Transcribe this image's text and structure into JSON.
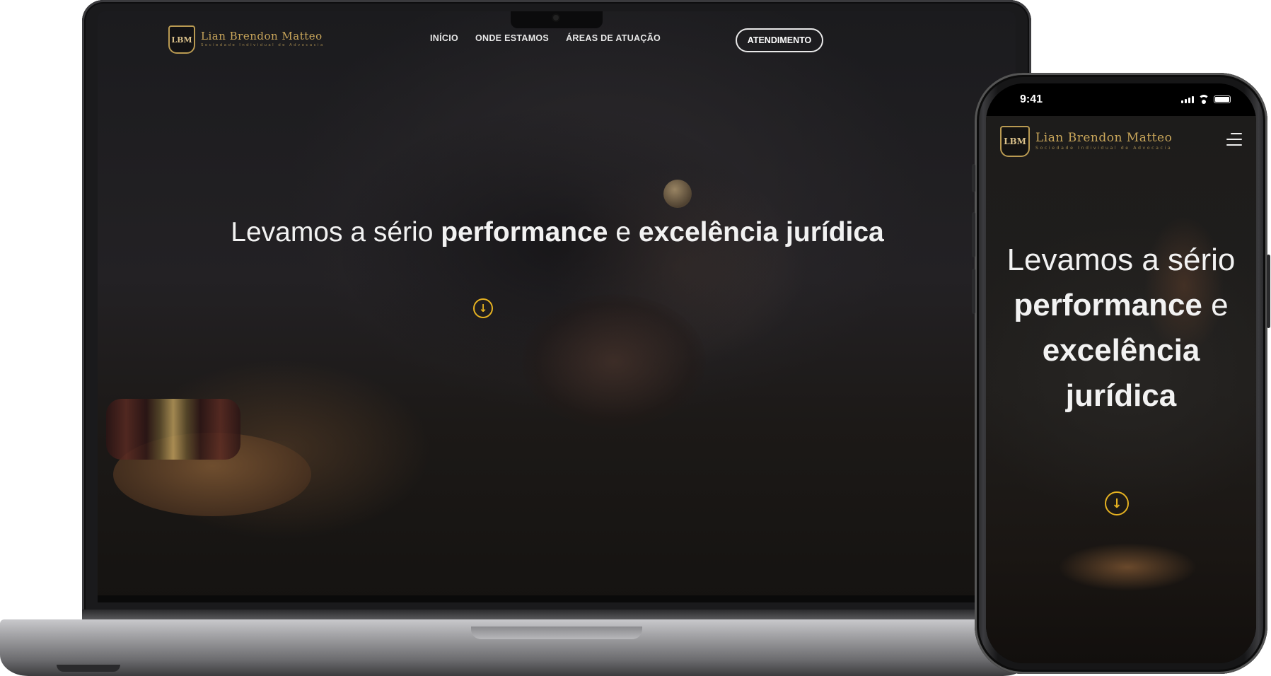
{
  "site": {
    "logo_initials": "LBM",
    "logo_name": "Lian Brendon Matteo",
    "logo_subtitle": "Sociedade Individual de Advocacia",
    "brand_gold": "#c9a65a",
    "accent_yellow": "#e6b221"
  },
  "nav": {
    "items": [
      "INÍCIO",
      "ONDE ESTAMOS",
      "ÁREAS DE ATUAÇÃO"
    ],
    "cta": "ATENDIMENTO"
  },
  "hero": {
    "line_regular_1": "Levamos a sério",
    "line_bold_1": "performance",
    "connector": "e",
    "line_bold_2": "excelência jurídica",
    "scroll_icon": "arrow-down-circle-icon"
  },
  "phone": {
    "status_time": "9:41",
    "menu_icon": "hamburger-menu-icon"
  }
}
